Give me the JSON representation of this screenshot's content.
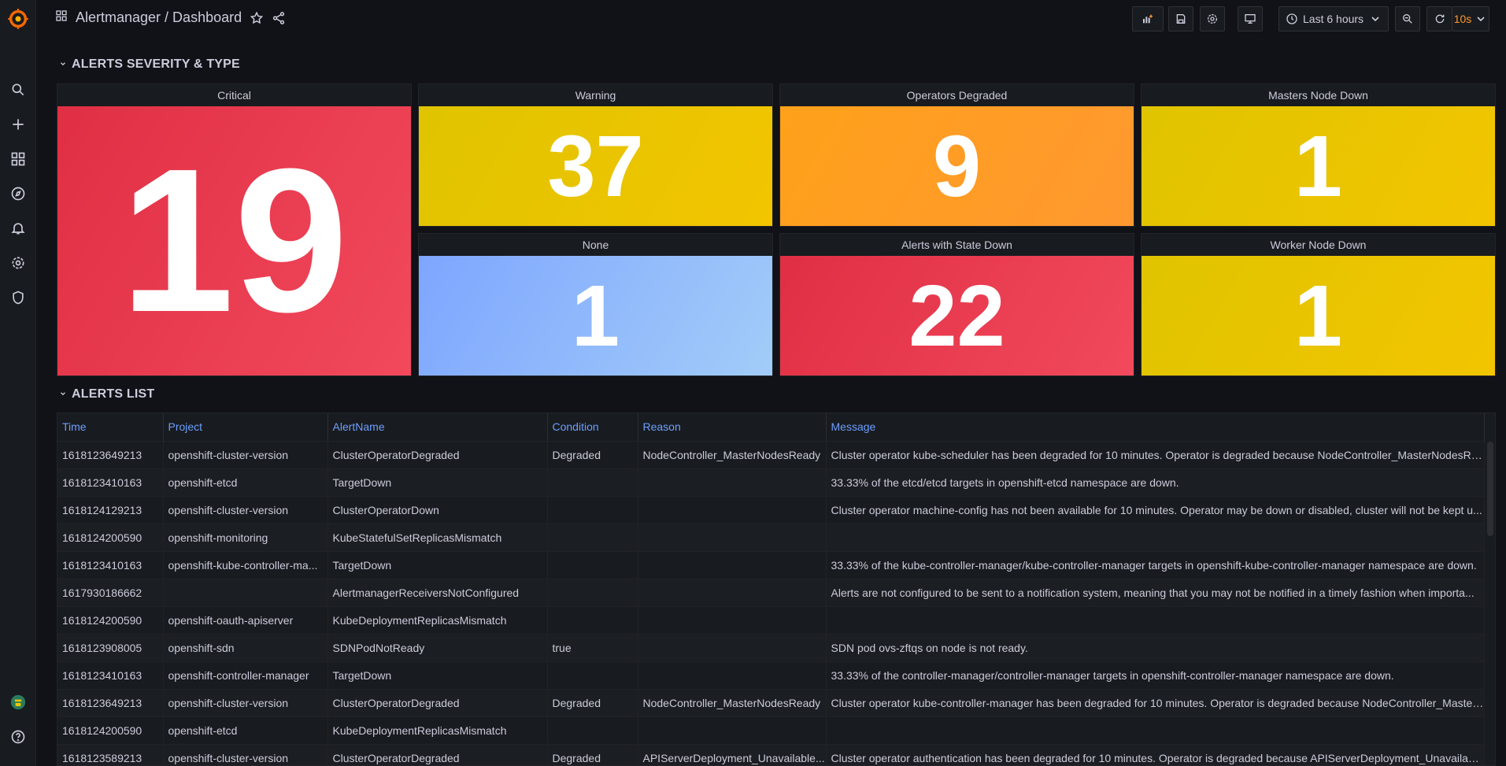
{
  "app": {
    "title": "Alertmanager / Dashboard"
  },
  "toolbar": {
    "time_range": "Last 6 hours",
    "refresh_interval": "10s"
  },
  "rows": {
    "severity": "ALERTS SEVERITY & TYPE",
    "list": "ALERTS LIST"
  },
  "stats": [
    {
      "title": "Critical",
      "value": "19",
      "gradient": [
        "#e02f44",
        "#f2495c"
      ]
    },
    {
      "title": "Warning",
      "value": "37",
      "gradient": [
        "#e0c400",
        "#f2c500"
      ]
    },
    {
      "title": "Operators Degraded",
      "value": "9",
      "gradient": [
        "#ffa11a",
        "#ff9830"
      ]
    },
    {
      "title": "Masters Node Down",
      "value": "1",
      "gradient": [
        "#e0c400",
        "#f2c500"
      ]
    },
    {
      "title": "None",
      "value": "1",
      "gradient": [
        "#7ea6ff",
        "#a2ccf8"
      ]
    },
    {
      "title": "Alerts with State Down",
      "value": "22",
      "gradient": [
        "#e02f44",
        "#f2495c"
      ]
    },
    {
      "title": "Worker Node Down",
      "value": "1",
      "gradient": [
        "#e0c400",
        "#f2c500"
      ]
    }
  ],
  "table": {
    "columns": [
      "Time",
      "Project",
      "AlertName",
      "Condition",
      "Reason",
      "Message"
    ],
    "rows": [
      [
        "1618123649213",
        "openshift-cluster-version",
        "ClusterOperatorDegraded",
        "Degraded",
        "NodeController_MasterNodesReady",
        "Cluster operator kube-scheduler has been degraded for 10 minutes. Operator is degraded because NodeController_MasterNodesRe..."
      ],
      [
        "1618123410163",
        "openshift-etcd",
        "TargetDown",
        "",
        "",
        "33.33% of the etcd/etcd targets in openshift-etcd namespace are down."
      ],
      [
        "1618124129213",
        "openshift-cluster-version",
        "ClusterOperatorDown",
        "",
        "",
        "Cluster operator machine-config has not been available for 10 minutes. Operator may be down or disabled, cluster will not be kept u..."
      ],
      [
        "1618124200590",
        "openshift-monitoring",
        "KubeStatefulSetReplicasMismatch",
        "",
        "",
        ""
      ],
      [
        "1618123410163",
        "openshift-kube-controller-ma...",
        "TargetDown",
        "",
        "",
        "33.33% of the kube-controller-manager/kube-controller-manager targets in openshift-kube-controller-manager namespace are down."
      ],
      [
        "1617930186662",
        "",
        "AlertmanagerReceiversNotConfigured",
        "",
        "",
        "Alerts are not configured to be sent to a notification system, meaning that you may not be notified in a timely fashion when importa..."
      ],
      [
        "1618124200590",
        "openshift-oauth-apiserver",
        "KubeDeploymentReplicasMismatch",
        "",
        "",
        ""
      ],
      [
        "1618123908005",
        "openshift-sdn",
        "SDNPodNotReady",
        "true",
        "",
        "SDN pod ovs-zftqs on node is not ready."
      ],
      [
        "1618123410163",
        "openshift-controller-manager",
        "TargetDown",
        "",
        "",
        "33.33% of the controller-manager/controller-manager targets in openshift-controller-manager namespace are down."
      ],
      [
        "1618123649213",
        "openshift-cluster-version",
        "ClusterOperatorDegraded",
        "Degraded",
        "NodeController_MasterNodesReady",
        "Cluster operator kube-controller-manager has been degraded for 10 minutes. Operator is degraded because NodeController_Master..."
      ],
      [
        "1618124200590",
        "openshift-etcd",
        "KubeDeploymentReplicasMismatch",
        "",
        "",
        ""
      ],
      [
        "1618123589213",
        "openshift-cluster-version",
        "ClusterOperatorDegraded",
        "Degraded",
        "APIServerDeployment_Unavailable...",
        "Cluster operator authentication has been degraded for 10 minutes. Operator is degraded because APIServerDeployment_Unavailabl..."
      ]
    ]
  },
  "colors": {
    "accent": "#6e9fff",
    "refresh": "#ff9830",
    "logo": "#f46800"
  }
}
